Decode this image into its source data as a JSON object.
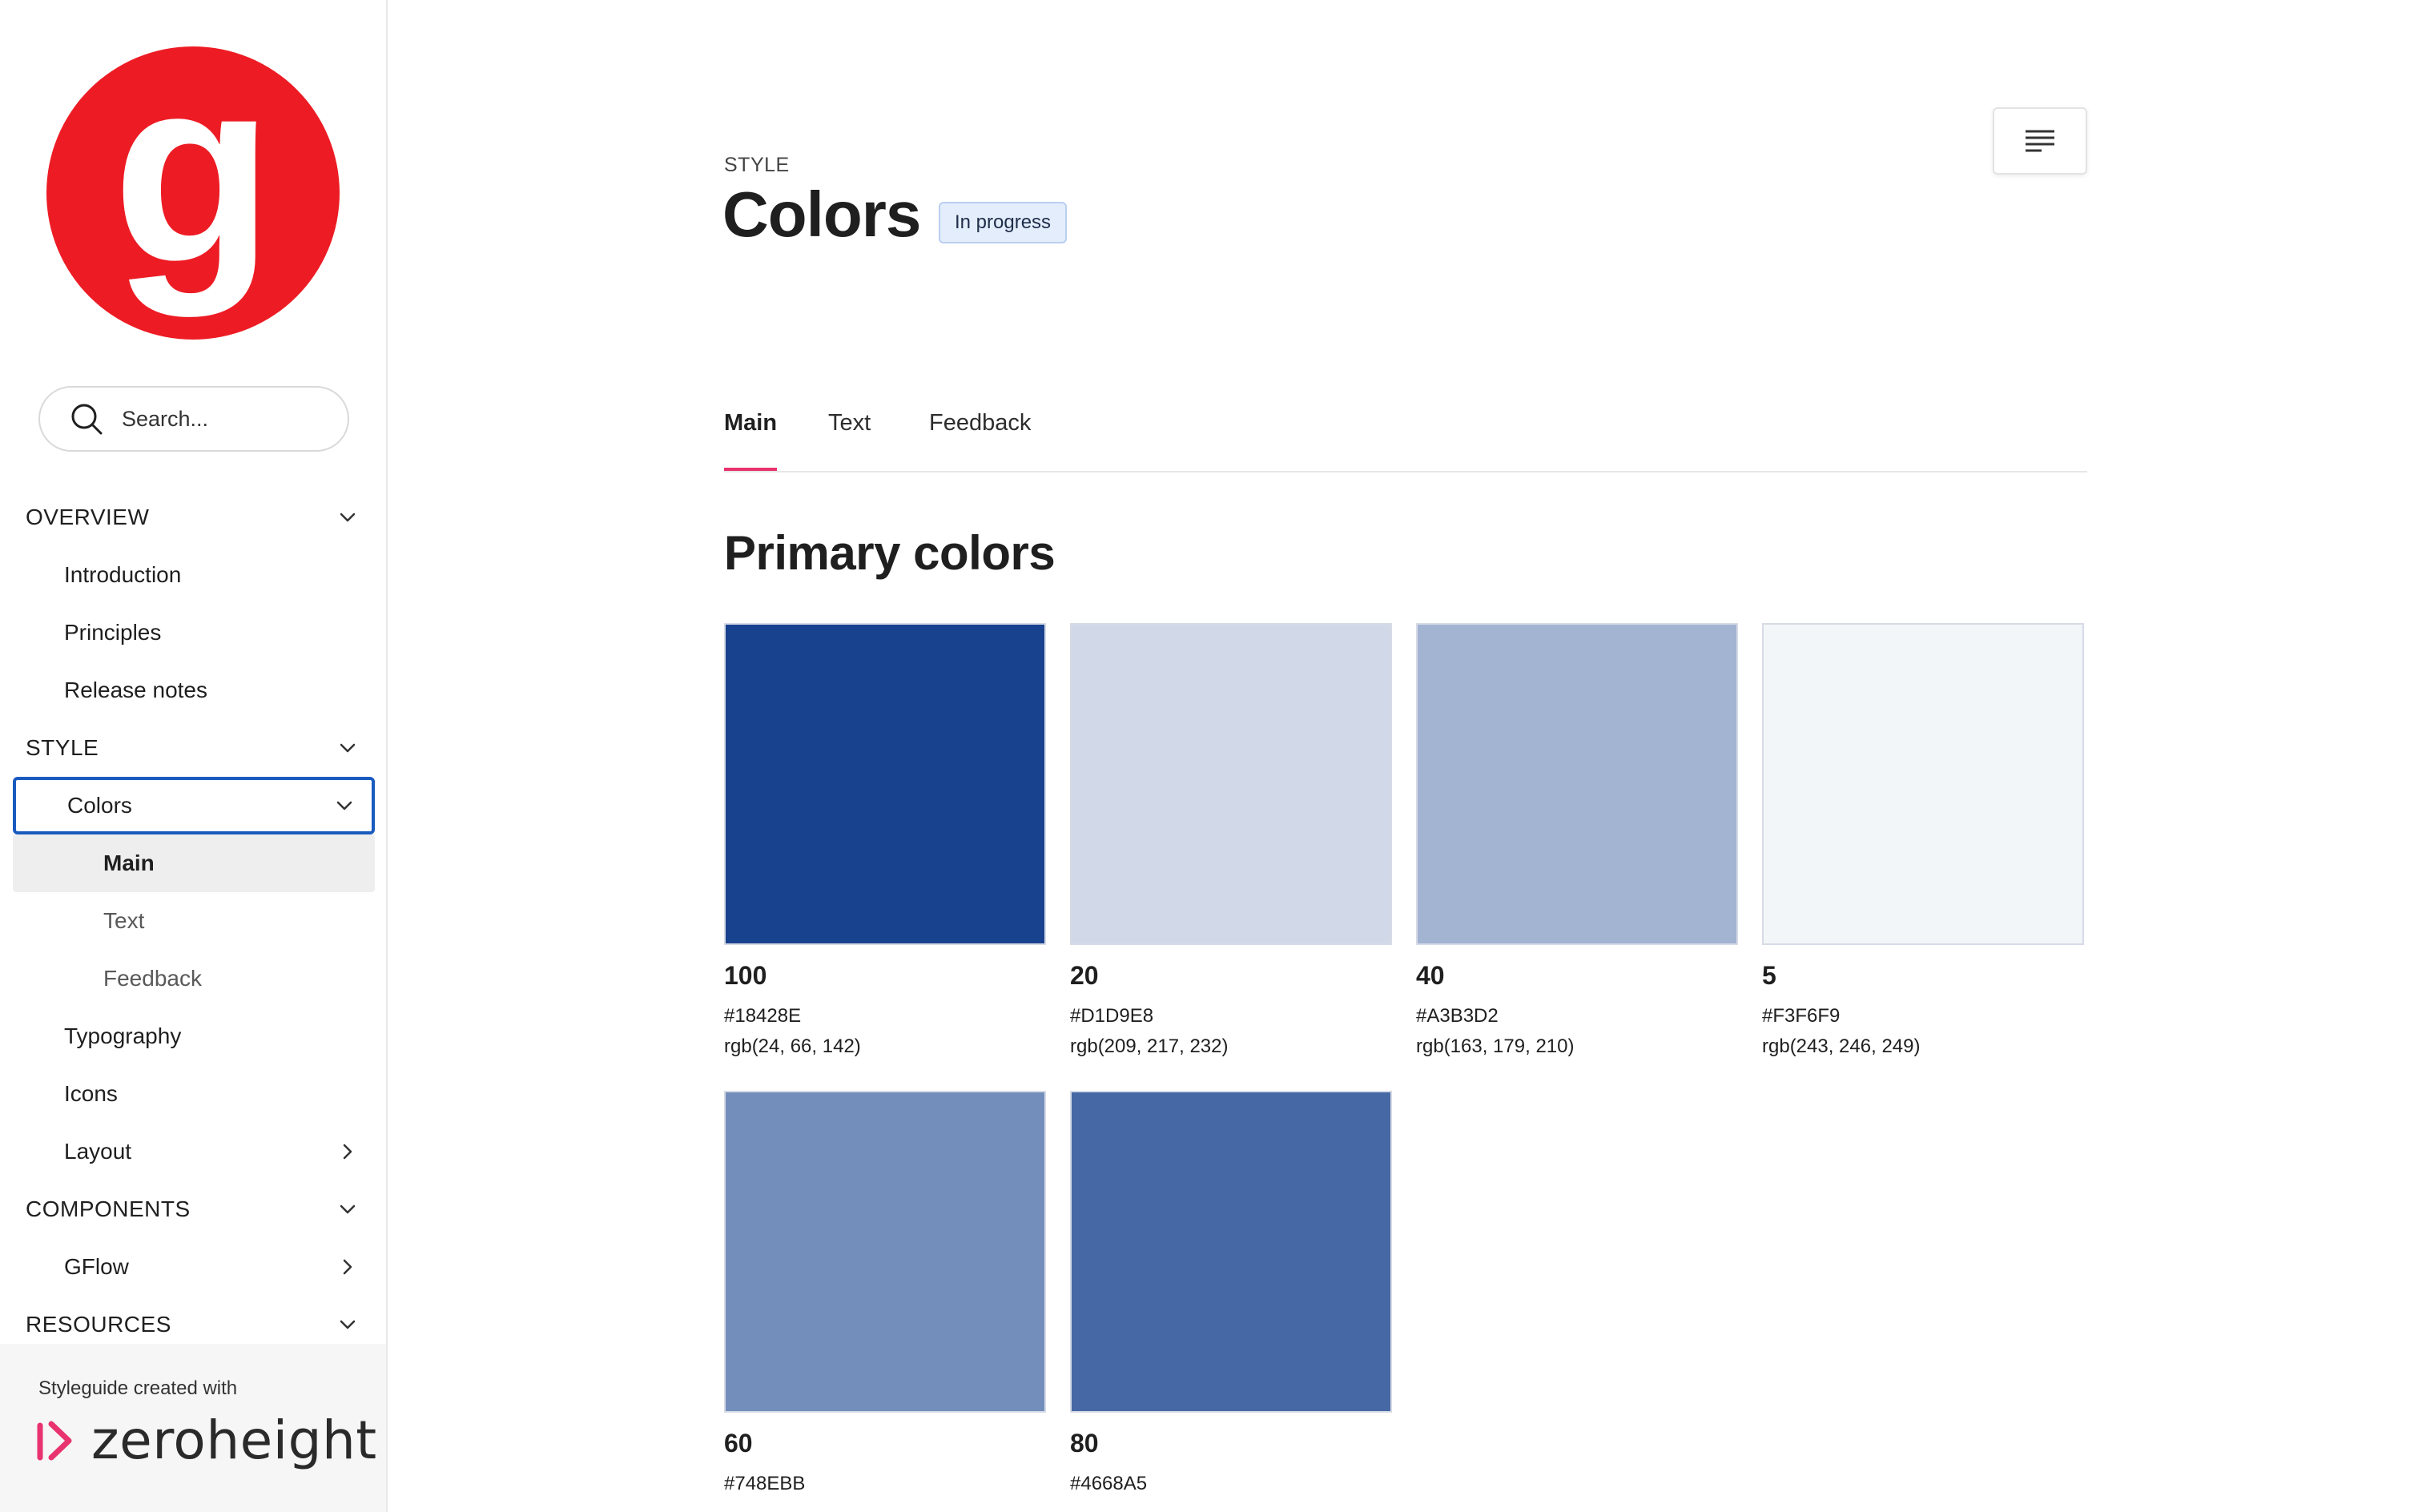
{
  "sidebar": {
    "search_placeholder": "Search...",
    "nav": [
      {
        "label": "OVERVIEW",
        "kind": "section",
        "chevron": "down"
      },
      {
        "label": "Introduction",
        "kind": "lvl1"
      },
      {
        "label": "Principles",
        "kind": "lvl1"
      },
      {
        "label": "Release notes",
        "kind": "lvl1"
      },
      {
        "label": "STYLE",
        "kind": "section",
        "chevron": "down"
      },
      {
        "label": "Colors",
        "kind": "lvl1",
        "chevron": "down",
        "state": "focused"
      },
      {
        "label": "Main",
        "kind": "lvl2",
        "state": "selected"
      },
      {
        "label": "Text",
        "kind": "lvl2"
      },
      {
        "label": "Feedback",
        "kind": "lvl2"
      },
      {
        "label": "Typography",
        "kind": "lvl1"
      },
      {
        "label": "Icons",
        "kind": "lvl1"
      },
      {
        "label": "Layout",
        "kind": "lvl1",
        "chevron": "right"
      },
      {
        "label": "COMPONENTS",
        "kind": "section",
        "chevron": "down"
      },
      {
        "label": "GFlow",
        "kind": "lvl1",
        "chevron": "right"
      },
      {
        "label": "RESOURCES",
        "kind": "section",
        "chevron": "down"
      }
    ],
    "footer": {
      "caption": "Styleguide created with",
      "brand": "zeroheight"
    }
  },
  "header": {
    "eyebrow": "STYLE",
    "title": "Colors",
    "status": "In progress",
    "toc_icon": "table-of-contents-icon"
  },
  "tabs": [
    {
      "label": "Main",
      "active": true
    },
    {
      "label": "Text",
      "active": false
    },
    {
      "label": "Feedback",
      "active": false
    }
  ],
  "primary": {
    "title": "Primary colors",
    "swatches": [
      {
        "name": "100",
        "hex": "#18428E",
        "rgb": "rgb(24, 66, 142)"
      },
      {
        "name": "20",
        "hex": "#D1D9E8",
        "rgb": "rgb(209, 217, 232)"
      },
      {
        "name": "40",
        "hex": "#A3B3D2",
        "rgb": "rgb(163, 179, 210)"
      },
      {
        "name": "5",
        "hex": "#F3F6F9",
        "rgb": "rgb(243, 246, 249)"
      },
      {
        "name": "60",
        "hex": "#748EBB",
        "rgb": ""
      },
      {
        "name": "80",
        "hex": "#4668A5",
        "rgb": ""
      }
    ]
  },
  "colors": {
    "brand_red": "#ED1C24",
    "accent_pink": "#E8336F",
    "focus_blue": "#1A5BBF"
  }
}
